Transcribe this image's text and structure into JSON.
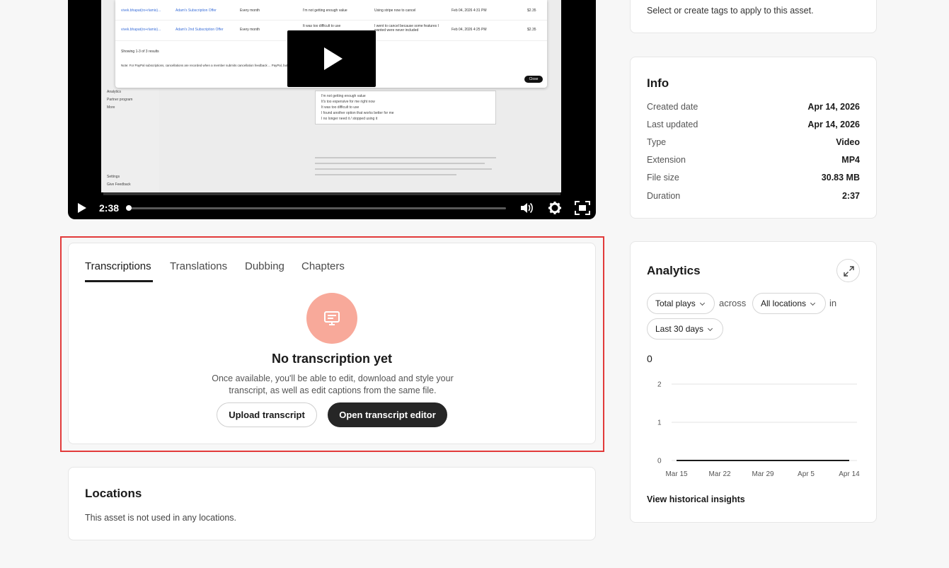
{
  "player": {
    "time": "2:38",
    "embedded": {
      "rows": [
        {
          "email": "vivek.bhapat(ro+rlamis)...",
          "offer": "Adam's Subscription Offer",
          "freq": "Every month",
          "reason": "I'm not getting enough value",
          "feedback": "Using stripe now to cancel",
          "date": "Feb 04, 2026 4:31 PM",
          "amount": "$2.35"
        },
        {
          "email": "vivek.bhapat(ro+rlamis)...",
          "offer": "Adam's 2nd Subscription Offer",
          "freq": "Every month",
          "reason": "It was too difficult to use",
          "feedback": "I went to cancel because some features I wanted were never included",
          "date": "Feb 04, 2026 4:25 PM",
          "amount": "$2.35"
        }
      ],
      "showing": "Showing 1-3 of 3 results",
      "note": "Note: For PayPal subscriptions, cancellations are recorded when a member submits cancellation feedback ... PayPal, but the record will still appear here.",
      "close": "Close",
      "sidebar_items": [
        "Analytics",
        "Partner program",
        "More",
        "Settings",
        "Give Feedback"
      ],
      "reasons": [
        "I'm not getting enough value",
        "It's too expensive for me right now",
        "It was too difficult to use",
        "I found another option that works better for me",
        "I no longer need it / stopped using it"
      ]
    }
  },
  "transcriptions": {
    "tabs": [
      "Transcriptions",
      "Translations",
      "Dubbing",
      "Chapters"
    ],
    "empty_title": "No transcription yet",
    "empty_desc": "Once available, you'll be able to edit, download and style your transcript, as well as edit captions from the same file.",
    "upload_label": "Upload transcript",
    "editor_label": "Open transcript editor"
  },
  "locations": {
    "title": "Locations",
    "desc": "This asset is not used in any locations."
  },
  "tags": {
    "desc": "Select or create tags to apply to this asset."
  },
  "info": {
    "title": "Info",
    "rows": [
      {
        "k": "Created date",
        "v": "Apr 14, 2026"
      },
      {
        "k": "Last updated",
        "v": "Apr 14, 2026"
      },
      {
        "k": "Type",
        "v": "Video"
      },
      {
        "k": "Extension",
        "v": "MP4"
      },
      {
        "k": "File size",
        "v": "30.83 MB"
      },
      {
        "k": "Duration",
        "v": "2:37"
      }
    ]
  },
  "analytics": {
    "title": "Analytics",
    "metric": "Total plays",
    "across": "across",
    "location": "All locations",
    "in": "in",
    "period": "Last 30 days",
    "total": "0",
    "view_link": "View historical insights"
  },
  "chart_data": {
    "type": "line",
    "x": [
      "Mar 15",
      "Mar 22",
      "Mar 29",
      "Apr 5",
      "Apr 14"
    ],
    "series": [
      {
        "values": [
          0,
          0,
          0,
          0,
          0
        ]
      }
    ],
    "yticks": [
      "2",
      "1",
      "0"
    ],
    "ylim": [
      0,
      2
    ],
    "grid": true,
    "color": "#1a1a1a"
  },
  "colors": {
    "accent_circle": "#f8a99a",
    "highlight_border": "#e23a3a",
    "dark_button": "#262626"
  }
}
